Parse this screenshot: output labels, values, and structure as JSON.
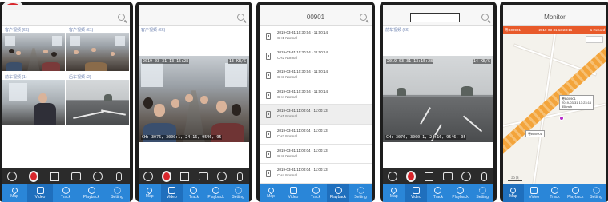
{
  "screens": [
    {
      "id": "live-quad",
      "captions": [
        "客户视频 (66)",
        "客户视频 (61)",
        "前车视频 (1)",
        "后车视频 (2)"
      ]
    },
    {
      "id": "live-single",
      "caption": "客户视频 (66)",
      "osd_top": "2019-03-31 13:15:28",
      "osd_right": "13 KB/S",
      "osd_bottom": "CH: 3076, 3000:1, 24:16, 9546, 95"
    },
    {
      "id": "playback-list",
      "title": "00901",
      "rows": [
        {
          "time": "2019-03-31 10:30:04 - 11:00:14",
          "status": "CH1 Normal"
        },
        {
          "time": "2019-03-31 10:30:04 - 11:00:14",
          "status": "CH2 Normal"
        },
        {
          "time": "2019-03-31 10:30:04 - 11:00:14",
          "status": "CH3 Normal"
        },
        {
          "time": "2019-03-31 10:30:04 - 11:00:14",
          "status": "CH4 Normal"
        },
        {
          "time": "2019-03-31 11:00:04 - 11:00:13",
          "status": "CH1 Normal"
        },
        {
          "time": "2019-03-31 11:00:04 - 11:00:13",
          "status": "CH2 Normal"
        },
        {
          "time": "2019-03-31 11:00:04 - 11:00:13",
          "status": "CH3 Normal"
        },
        {
          "time": "2019-03-31 11:00:04 - 11:00:13",
          "status": "CH4 Normal"
        }
      ]
    },
    {
      "id": "live-road",
      "caption": "前车视频 (66)",
      "osd_top": "2019-03-31 13:15:28",
      "osd_right": "14 KB/S",
      "osd_bottom": "CH: 3076, 3000:1, 24:16, 9546, 95"
    },
    {
      "id": "monitor",
      "title": "Monitor",
      "info_left": "粤B00901",
      "info_mid": "2019-03-31 13:23:16",
      "info_right": "1 Record",
      "tip1": "粤B00901\n2019-03-31 13:23:16\n85km/h",
      "tip2": "粤B00901",
      "scale": "20 米"
    }
  ],
  "tabs": [
    "Map",
    "Video",
    "Track",
    "Playback",
    "Setting"
  ],
  "colors": {
    "tabbar": "#2a86d8",
    "record": "#d8262c",
    "route": "#f3a43b",
    "vehicle": "#b52bc9"
  }
}
